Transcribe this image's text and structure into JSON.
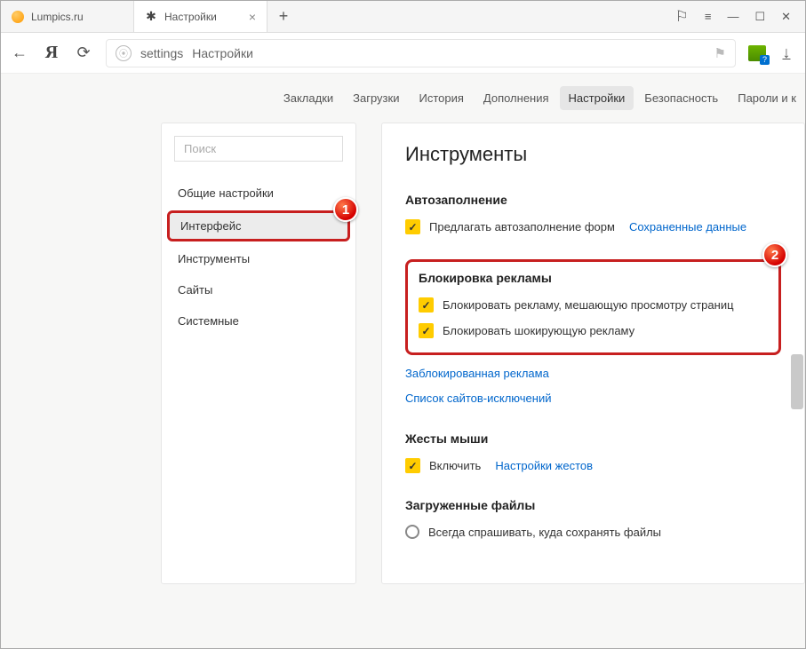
{
  "tabs": [
    {
      "title": "Lumpics.ru"
    },
    {
      "title": "Настройки"
    }
  ],
  "address": {
    "prefix": "settings",
    "page": "Настройки"
  },
  "topnav": {
    "items": [
      "Закладки",
      "Загрузки",
      "История",
      "Дополнения",
      "Настройки",
      "Безопасность",
      "Пароли и к"
    ],
    "activeIndex": 4
  },
  "sidebar": {
    "search_placeholder": "Поиск",
    "items": [
      "Общие настройки",
      "Интерфейс",
      "Инструменты",
      "Сайты",
      "Системные"
    ],
    "activeIndex": 1
  },
  "main": {
    "title": "Инструменты",
    "autofill": {
      "heading": "Автозаполнение",
      "cb1": "Предлагать автозаполнение форм",
      "link1": "Сохраненные данные"
    },
    "adblock": {
      "heading": "Блокировка рекламы",
      "cb1": "Блокировать рекламу, мешающую просмотру страниц",
      "cb2": "Блокировать шокирующую рекламу",
      "link1": "Заблокированная реклама",
      "link2": "Список сайтов-исключений"
    },
    "gestures": {
      "heading": "Жесты мыши",
      "cb1": "Включить",
      "link1": "Настройки жестов"
    },
    "downloads": {
      "heading": "Загруженные файлы",
      "r1": "Всегда спрашивать, куда сохранять файлы"
    }
  },
  "annotations": {
    "b1": "1",
    "b2": "2"
  }
}
